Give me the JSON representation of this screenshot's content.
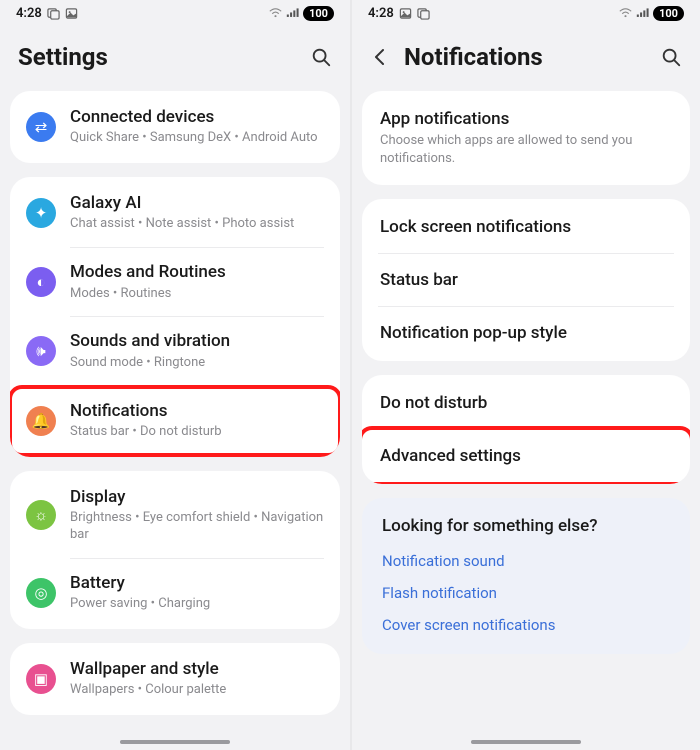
{
  "status": {
    "time": "4:28",
    "battery": "100"
  },
  "left": {
    "title": "Settings",
    "groups": [
      {
        "items": [
          {
            "icon": "devices-icon",
            "color": "c-blue",
            "title": "Connected devices",
            "sub": "Quick Share  •  Samsung DeX  •  Android Auto"
          }
        ]
      },
      {
        "items": [
          {
            "icon": "galaxy-ai-icon",
            "color": "c-teal",
            "title": "Galaxy AI",
            "sub": "Chat assist  •  Note assist  •  Photo assist"
          },
          {
            "icon": "modes-icon",
            "color": "c-purple",
            "title": "Modes and Routines",
            "sub": "Modes  •  Routines"
          },
          {
            "icon": "sound-icon",
            "color": "c-violet",
            "title": "Sounds and vibration",
            "sub": "Sound mode  •  Ringtone"
          },
          {
            "icon": "bell-icon",
            "color": "c-orange",
            "title": "Notifications",
            "sub": "Status bar  •  Do not disturb",
            "highlight": true
          }
        ]
      },
      {
        "items": [
          {
            "icon": "display-icon",
            "color": "c-green",
            "title": "Display",
            "sub": "Brightness  •  Eye comfort shield  •  Navigation bar"
          },
          {
            "icon": "battery-icon",
            "color": "c-lime",
            "title": "Battery",
            "sub": "Power saving  •  Charging"
          }
        ]
      },
      {
        "items": [
          {
            "icon": "wallpaper-icon",
            "color": "c-pink",
            "title": "Wallpaper and style",
            "sub": "Wallpapers  •  Colour palette"
          }
        ]
      }
    ]
  },
  "right": {
    "title": "Notifications",
    "groups": [
      {
        "items": [
          {
            "title": "App notifications",
            "sub": "Choose which apps are allowed to send you notifications."
          }
        ]
      },
      {
        "items": [
          {
            "title": "Lock screen notifications"
          },
          {
            "title": "Status bar"
          },
          {
            "title": "Notification pop-up style"
          }
        ]
      },
      {
        "items": [
          {
            "title": "Do not disturb"
          },
          {
            "title": "Advanced settings",
            "highlight": true
          }
        ]
      }
    ],
    "suggest": {
      "heading": "Looking for something else?",
      "links": [
        "Notification sound",
        "Flash notification",
        "Cover screen notifications"
      ]
    }
  },
  "icons": {
    "devices-icon": "⇄",
    "galaxy-ai-icon": "✦",
    "modes-icon": "◐",
    "sound-icon": "🕪",
    "bell-icon": "🔔",
    "display-icon": "☼",
    "battery-icon": "◎",
    "wallpaper-icon": "▣"
  }
}
